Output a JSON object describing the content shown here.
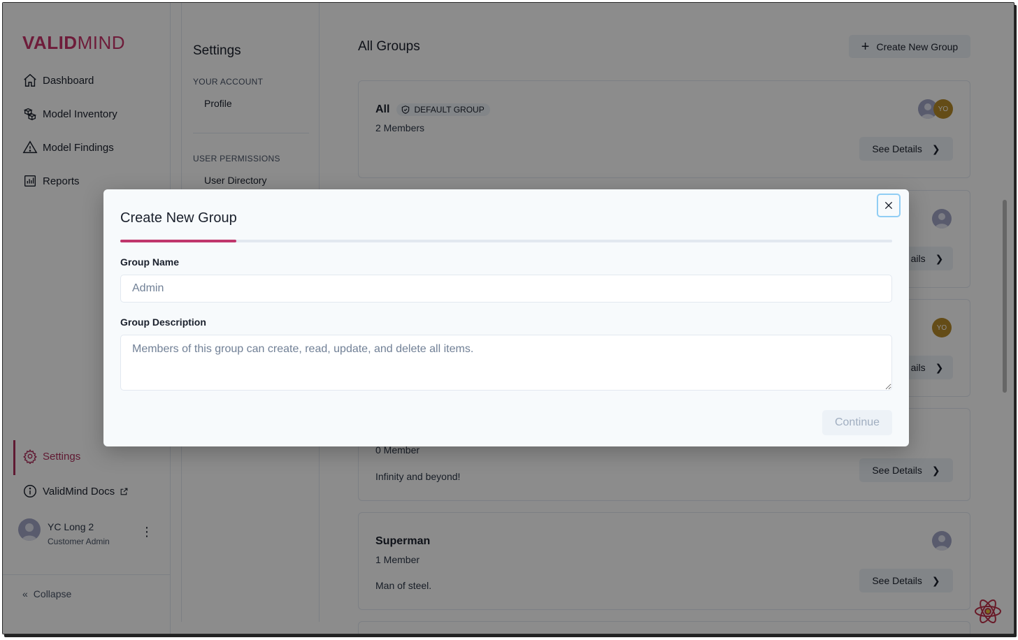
{
  "brand": {
    "logo_bold": "VALID",
    "logo_light": "MIND",
    "accent": "#c0366c"
  },
  "nav": {
    "items": [
      {
        "label": "Dashboard",
        "icon": "home-icon"
      },
      {
        "label": "Model Inventory",
        "icon": "cubes-icon"
      },
      {
        "label": "Model Findings",
        "icon": "warning-icon"
      },
      {
        "label": "Reports",
        "icon": "bar-chart-icon"
      }
    ],
    "settings_label": "Settings",
    "docs_label": "ValidMind Docs",
    "user": {
      "name": "YC Long 2",
      "role": "Customer Admin"
    },
    "collapse_label": "Collapse"
  },
  "settings": {
    "title": "Settings",
    "your_account": "YOUR ACCOUNT",
    "profile": "Profile",
    "user_permissions": "USER PERMISSIONS",
    "user_directory": "User Directory"
  },
  "main": {
    "title": "All Groups",
    "create_label": "Create New Group",
    "see_details": "See Details",
    "partial_details": "ails",
    "groups": [
      {
        "name": "All",
        "badge": "DEFAULT GROUP",
        "members": "2 Members",
        "description": ""
      },
      {
        "name": "",
        "members": "0 Member",
        "description": "Infinity and beyond!"
      },
      {
        "name": "Superman",
        "members": "1 Member",
        "description": "Man of steel."
      }
    ],
    "avatar_initials": "YO"
  },
  "modal": {
    "title": "Create New Group",
    "progress": 0.15,
    "group_name_label": "Group Name",
    "group_name_placeholder": "Admin",
    "group_description_label": "Group Description",
    "group_description_placeholder": "Members of this group can create, read, update, and delete all items.",
    "continue_label": "Continue"
  }
}
